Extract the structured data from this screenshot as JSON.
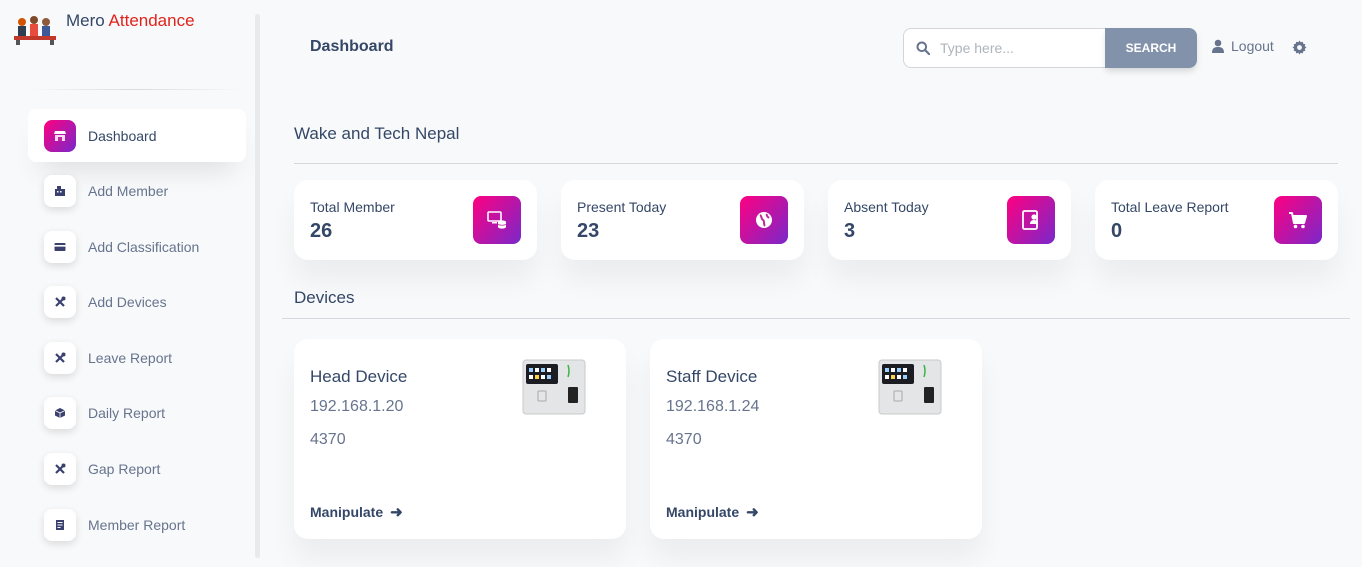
{
  "brand": {
    "name": "Mero",
    "accent": "Attendance"
  },
  "sidebar": {
    "items": [
      {
        "label": "Dashboard",
        "icon": "shop-icon",
        "active": true
      },
      {
        "label": "Add Member",
        "icon": "office-icon"
      },
      {
        "label": "Add Classification",
        "icon": "credit-card-icon"
      },
      {
        "label": "Add Devices",
        "icon": "tools-icon"
      },
      {
        "label": "Leave Report",
        "icon": "tools-icon"
      },
      {
        "label": "Daily Report",
        "icon": "box-icon"
      },
      {
        "label": "Gap Report",
        "icon": "tools-icon"
      },
      {
        "label": "Member Report",
        "icon": "document-icon"
      }
    ]
  },
  "header": {
    "title": "Dashboard",
    "search_placeholder": "Type here...",
    "search_button": "SEARCH",
    "logout": "Logout"
  },
  "main": {
    "org_name": "Wake and Tech Nepal",
    "stats": [
      {
        "label": "Total Member",
        "value": "26",
        "icon": "monitor-database-icon"
      },
      {
        "label": "Present Today",
        "value": "23",
        "icon": "globe-icon"
      },
      {
        "label": "Absent Today",
        "value": "3",
        "icon": "user-card-icon"
      },
      {
        "label": "Total Leave Report",
        "value": "0",
        "icon": "cart-icon"
      }
    ],
    "devices_title": "Devices",
    "devices": [
      {
        "name": "Head Device",
        "ip": "192.168.1.20",
        "port": "4370",
        "action": "Manipulate"
      },
      {
        "name": "Staff Device",
        "ip": "192.168.1.24",
        "port": "4370",
        "action": "Manipulate"
      }
    ]
  },
  "colors": {
    "accent_gradient_start": "#7928ca",
    "accent_gradient_end": "#ff0080",
    "brand_accent": "#e0231c",
    "search_button": "#8392ab"
  }
}
